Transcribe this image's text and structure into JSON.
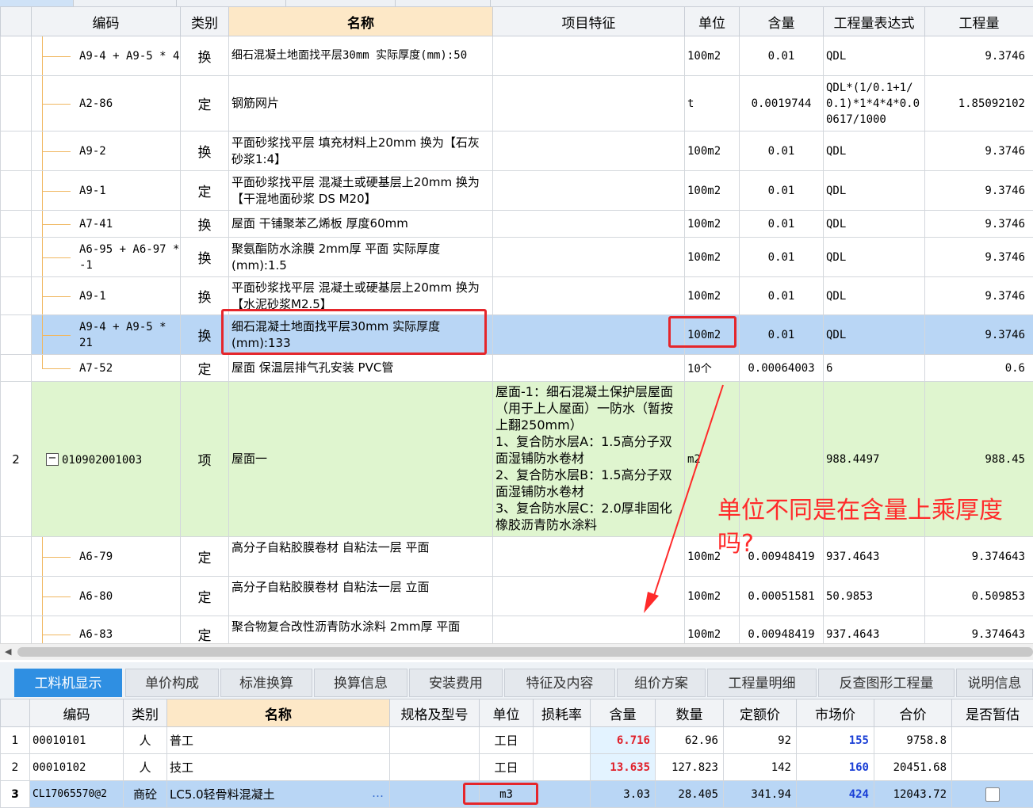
{
  "top_table": {
    "headers": {
      "code": "编码",
      "category": "类别",
      "name": "名称",
      "feature": "项目特征",
      "unit": "单位",
      "content": "含量",
      "expression": "工程量表达式",
      "quantity": "工程量"
    },
    "rows": [
      {
        "code": "A9-4 + A9-5 * 4",
        "category": "换",
        "name": "细石混凝土地面找平层30mm  实际厚度(mm):50",
        "feature": "",
        "unit": "100m2",
        "content": "0.01",
        "expression": "QDL",
        "quantity": "9.3746"
      },
      {
        "code": "A2-86",
        "category": "定",
        "name": "钢筋网片",
        "feature": "",
        "unit": "t",
        "content": "0.0019744",
        "expression": "QDL*(1/0.1+1/0.1)*1*4*4*0.00617/1000",
        "quantity": "1.85092102"
      },
      {
        "code": "A9-2",
        "category": "换",
        "name": "平面砂浆找平层 填充材料上20mm  换为【石灰砂浆1:4】",
        "feature": "",
        "unit": "100m2",
        "content": "0.01",
        "expression": "QDL",
        "quantity": "9.3746"
      },
      {
        "code": "A9-1",
        "category": "定",
        "name": "平面砂浆找平层 混凝土或硬基层上20mm  换为【干混地面砂浆 DS M20】",
        "feature": "",
        "unit": "100m2",
        "content": "0.01",
        "expression": "QDL",
        "quantity": "9.3746"
      },
      {
        "code": "A7-41",
        "category": "换",
        "name": "屋面 干铺聚苯乙烯板 厚度60mm",
        "feature": "",
        "unit": "100m2",
        "content": "0.01",
        "expression": "QDL",
        "quantity": "9.3746"
      },
      {
        "code": "A6-95 + A6-97 * -1",
        "category": "换",
        "name": "聚氨酯防水涂膜 2mm厚 平面  实际厚度(mm):1.5",
        "feature": "",
        "unit": "100m2",
        "content": "0.01",
        "expression": "QDL",
        "quantity": "9.3746"
      },
      {
        "code": "A9-1",
        "category": "换",
        "name": "平面砂浆找平层 混凝土或硬基层上20mm  换为【水泥砂浆M2.5】",
        "feature": "",
        "unit": "100m2",
        "content": "0.01",
        "expression": "QDL",
        "quantity": "9.3746"
      },
      {
        "code": "A9-4 + A9-5 * 21",
        "category": "换",
        "name": "细石混凝土地面找平层30mm  实际厚度(mm):133",
        "feature": "",
        "unit": "100m2",
        "content": "0.01",
        "expression": "QDL",
        "quantity": "9.3746"
      },
      {
        "code": "A7-52",
        "category": "定",
        "name": "屋面 保温层排气孔安装 PVC管",
        "feature": "",
        "unit": "10个",
        "content": "0.00064003",
        "expression": "6",
        "quantity": "0.6"
      },
      {
        "index": "2",
        "code": "010902001003",
        "category": "项",
        "name": "屋面一",
        "feature": "屋面-1：细石混凝土保护层屋面（用于上人屋面）一防水（暂按上翻250mm）\n1、复合防水层A：1.5高分子双面湿铺防水卷材\n2、复合防水层B：1.5高分子双面湿铺防水卷材\n3、复合防水层C：2.0厚非固化橡胶沥青防水涂料",
        "unit": "m2",
        "content": "",
        "expression": "988.4497",
        "quantity": "988.45"
      },
      {
        "code": "A6-79",
        "category": "定",
        "name": "高分子自粘胶膜卷材 自粘法一层 平面",
        "feature": "",
        "unit": "100m2",
        "content": "0.00948419",
        "expression": "937.4643",
        "quantity": "9.374643"
      },
      {
        "code": "A6-80",
        "category": "定",
        "name": "高分子自粘胶膜卷材 自粘法一层 立面",
        "feature": "",
        "unit": "100m2",
        "content": "0.00051581",
        "expression": "50.9853",
        "quantity": "0.509853"
      },
      {
        "code": "A6-83",
        "category": "定",
        "name": "聚合物复合改性沥青防水涂料 2mm厚 平面",
        "feature": "",
        "unit": "100m2",
        "content": "0.00948419",
        "expression": "937.4643",
        "quantity": "9.374643"
      }
    ]
  },
  "scrollbar": {
    "left_arrow": "◀"
  },
  "bottom_tabs": [
    "工料机显示",
    "单价构成",
    "标准换算",
    "换算信息",
    "安装费用",
    "特征及内容",
    "组价方案",
    "工程量明细",
    "反查图形工程量",
    "说明信息"
  ],
  "bottom_table": {
    "headers": {
      "code": "编码",
      "category": "类别",
      "name": "名称",
      "spec": "规格及型号",
      "unit": "单位",
      "loss": "损耗率",
      "content": "含量",
      "amount": "数量",
      "quota_price": "定额价",
      "market_price": "市场价",
      "total": "合价",
      "provisional": "是否暂估"
    },
    "rows": [
      {
        "index": "1",
        "code": "00010101",
        "category": "人",
        "name": "普工",
        "spec": "",
        "unit": "工日",
        "loss": "",
        "content": "6.716",
        "amount": "62.96",
        "quota_price": "92",
        "market_price": "155",
        "total": "9758.8"
      },
      {
        "index": "2",
        "code": "00010102",
        "category": "人",
        "name": "技工",
        "spec": "",
        "unit": "工日",
        "loss": "",
        "content": "13.635",
        "amount": "127.823",
        "quota_price": "142",
        "market_price": "160",
        "total": "20451.68"
      },
      {
        "index": "3",
        "code": "CL17065570@2",
        "category": "商砼",
        "name": "LC5.0轻骨料混凝土",
        "name_ellipsis": "…",
        "spec": "",
        "unit": "m3",
        "loss": "",
        "content": "3.03",
        "amount": "28.405",
        "quota_price": "341.94",
        "market_price": "424",
        "total": "12043.72"
      }
    ]
  },
  "annotation": {
    "text": "单位不同是在含量上乘厚度吗?",
    "color": "#ff2a2a"
  },
  "colors": {
    "selected_row": "#b9d6f5",
    "item_row": "#dff5cf",
    "name_header": "#fde8c7",
    "active_tab": "#2f8fe2",
    "red_box": "#e5262b"
  }
}
